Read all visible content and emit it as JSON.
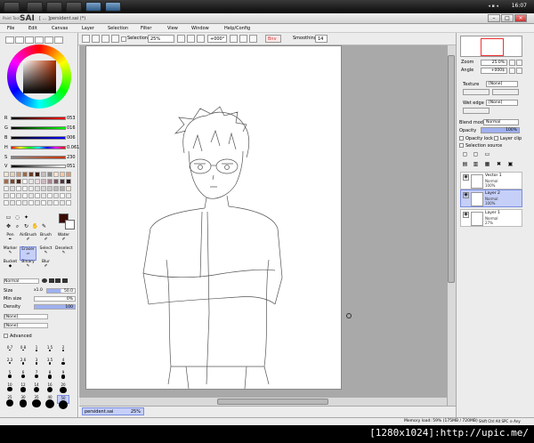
{
  "taskbar": {
    "clock": "16:07",
    "tray": "◂ ▪ ◂"
  },
  "window": {
    "app_name": "SAI",
    "app_prefix": "Paint Tool",
    "title": "[ ... ]persident.sai (*)"
  },
  "menu": [
    "File",
    "Edit",
    "Canvas",
    "Layer",
    "Selection",
    "Filter",
    "View",
    "Window",
    "Help/Config"
  ],
  "toolbar": {
    "selection_label": "Selection",
    "zoom_value": "25%",
    "angle_value": "+000°",
    "mode_label": "Bnv",
    "smoothing_label": "Smoothing",
    "smoothing_value": "14"
  },
  "color_sliders": [
    {
      "label": "R",
      "value": "053",
      "color": "#e03030"
    },
    {
      "label": "G",
      "value": "016",
      "color": "#30b030"
    },
    {
      "label": "B",
      "value": "006",
      "color": "#3050e0"
    },
    {
      "label": "H",
      "value": "0.061",
      "color": "#e06000"
    },
    {
      "label": "S",
      "value": "230",
      "color": "#c03000"
    },
    {
      "label": "V",
      "value": "051",
      "color": "#303030"
    }
  ],
  "tools": [
    {
      "label": "Pen",
      "icon": "pen-icon"
    },
    {
      "label": "AirBrush",
      "icon": "airbrush-icon"
    },
    {
      "label": "Brush",
      "icon": "brush-icon"
    },
    {
      "label": "Water",
      "icon": "water-icon"
    },
    {
      "label": "Marker",
      "icon": "marker-icon"
    },
    {
      "label": "Eraser",
      "icon": "eraser-icon"
    },
    {
      "label": "Select",
      "icon": "select-icon"
    },
    {
      "label": "Deselect",
      "icon": "deselect-icon"
    },
    {
      "label": "Bucket",
      "icon": "bucket-icon"
    },
    {
      "label": "Binary",
      "icon": "binary-icon"
    },
    {
      "label": "Blur",
      "icon": "blur-icon"
    }
  ],
  "brush_props": {
    "blend_mode": "Normal",
    "size_label": "Size",
    "size_mult": "x1.0",
    "size_value": "50.0",
    "min_size_label": "Min size",
    "min_size_value": "0%",
    "density_label": "Density",
    "density_value": "100",
    "shape_select": "[None]",
    "texture_select": "[None]",
    "advanced_label": "Advanced"
  },
  "brush_sizes": [
    "0.7",
    "0.8",
    "1",
    "1.5",
    "2",
    "2.3",
    "2.6",
    "3",
    "3.5",
    "4",
    "5",
    "6",
    "7",
    "8",
    "9",
    "10",
    "12",
    "14",
    "16",
    "20",
    "25",
    "30",
    "35",
    "40",
    "50"
  ],
  "document_tab": {
    "name": "persident.sai",
    "zoom": "25%"
  },
  "status": {
    "memory": "Memory load: 59% (175MB / 720MB)",
    "keys": "Shift Ctrl Alt SPC ⊙ Any"
  },
  "right_panel": {
    "zoom_label": "Zoom",
    "zoom_value": "25.0%",
    "angle_label": "Angle",
    "angle_value": "+000$",
    "texture_label": "Texture",
    "texture_value": "[None]",
    "wet_edge_label": "Wet edge",
    "wet_edge_value": "[None]",
    "blend_mode_label": "Blend mode",
    "blend_mode_value": "Normal",
    "opacity_label": "Opacity",
    "opacity_value": "100%",
    "opacity_lock_label": "Opacity lock",
    "layer_clip_label": "Layer clip",
    "selection_source_label": "Selection source"
  },
  "layers": [
    {
      "name": "Vector 1",
      "mode": "Normal",
      "opacity": "100%",
      "selected": false
    },
    {
      "name": "Layer 2",
      "mode": "Normal",
      "opacity": "100%",
      "selected": true
    },
    {
      "name": "Layer 1",
      "mode": "Normal",
      "opacity": "27%",
      "selected": false
    }
  ],
  "watermark": "[1280x1024]:http://upic.me/"
}
